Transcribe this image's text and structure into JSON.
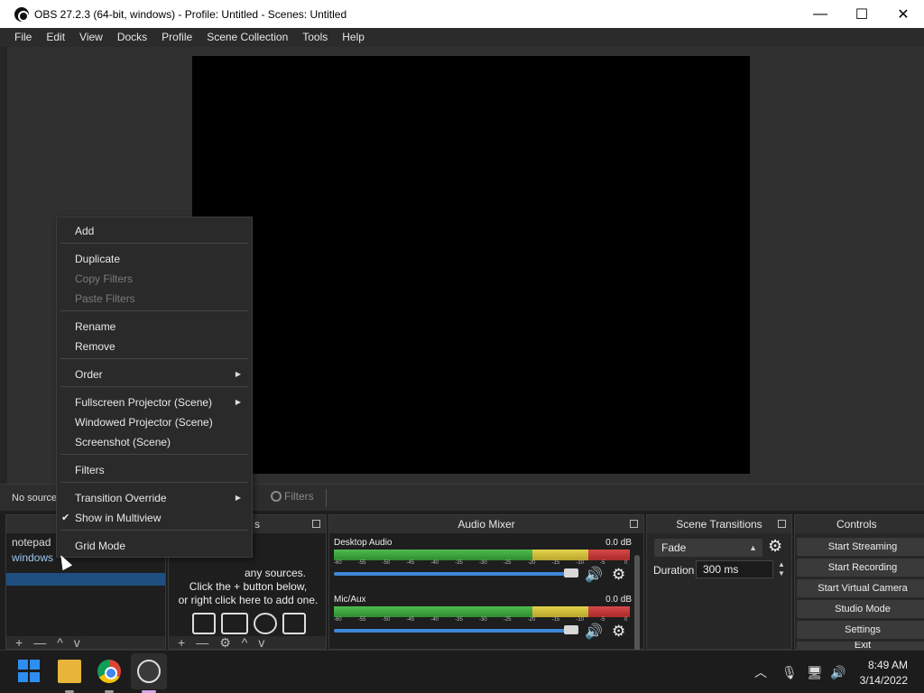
{
  "window": {
    "title": "OBS 27.2.3 (64-bit, windows) - Profile: Untitled - Scenes: Untitled",
    "minimize": "—",
    "maximize": "☐",
    "close": "✕"
  },
  "menu": [
    "File",
    "Edit",
    "View",
    "Docks",
    "Profile",
    "Scene Collection",
    "Tools",
    "Help"
  ],
  "toolbar": {
    "no_source": "No source",
    "properties": "s",
    "filters": "Filters"
  },
  "scenes": {
    "items": [
      "notepad",
      "windows"
    ],
    "footer": [
      "+",
      "—",
      "^",
      "v",
      "⌄"
    ]
  },
  "sources": {
    "title": "s",
    "hint_line1": "any sources.",
    "hint_line2": "Click the + button below,",
    "hint_line3": "or right click here to add one."
  },
  "mixer": {
    "title": "Audio Mixer",
    "ticks": [
      "-60",
      "-55",
      "-50",
      "-45",
      "-40",
      "-35",
      "-30",
      "-25",
      "-20",
      "-15",
      "-10",
      "-5",
      "0"
    ],
    "channels": [
      {
        "name": "Desktop Audio",
        "db": "0.0 dB"
      },
      {
        "name": "Mic/Aux",
        "db": "0.0 dB"
      }
    ]
  },
  "transitions": {
    "title": "Scene Transitions",
    "selected": "Fade",
    "duration_label": "Duration",
    "duration_value": "300 ms"
  },
  "controls": {
    "title": "Controls",
    "buttons": [
      "Start Streaming",
      "Start Recording",
      "Start Virtual Camera",
      "Studio Mode",
      "Settings",
      "Exit"
    ]
  },
  "context_menu": {
    "add": "Add",
    "duplicate": "Duplicate",
    "copy_filters": "Copy Filters",
    "paste_filters": "Paste Filters",
    "rename": "Rename",
    "remove": "Remove",
    "order": "Order",
    "fullscreen_projector": "Fullscreen Projector (Scene)",
    "windowed_projector": "Windowed Projector (Scene)",
    "screenshot": "Screenshot (Scene)",
    "filters": "Filters",
    "transition_override": "Transition Override",
    "show_in_multiview": "Show in Multiview",
    "grid_mode": "Grid Mode"
  },
  "taskbar": {
    "time": "8:49 AM",
    "date": "3/14/2022"
  }
}
